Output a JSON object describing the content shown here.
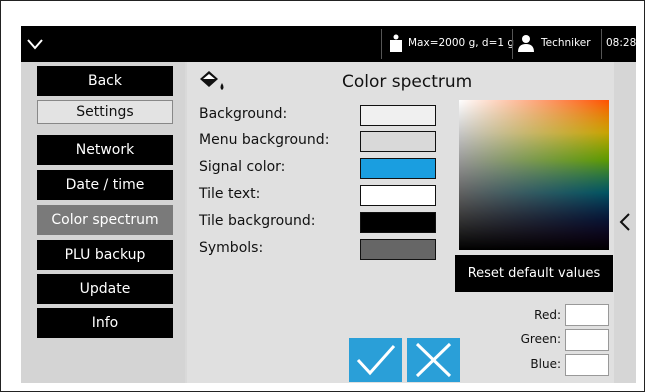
{
  "status_bar": {
    "scale_info": "Max=2000 g, d=1 g",
    "user": "Techniker",
    "time": "08:28"
  },
  "menu": {
    "items": [
      {
        "label": "Back"
      },
      {
        "label": "Settings"
      },
      {
        "label": "Network"
      },
      {
        "label": "Date / time"
      },
      {
        "label": "Color spectrum"
      },
      {
        "label": "PLU backup"
      },
      {
        "label": "Update"
      },
      {
        "label": "Info"
      }
    ],
    "active": "Color spectrum"
  },
  "main": {
    "title": "Color spectrum",
    "rows": [
      {
        "label": "Background:",
        "color": "#f0f0f0"
      },
      {
        "label": "Menu background:",
        "color": "#d9d9d9"
      },
      {
        "label": "Signal color:",
        "color": "#1a9ee0"
      },
      {
        "label": "Tile text:",
        "color": "#ffffff"
      },
      {
        "label": "Tile background:",
        "color": "#000000"
      },
      {
        "label": "Symbols:",
        "color": "#666666"
      }
    ],
    "reset_label": "Reset default values",
    "rgb": {
      "red_label": "Red:",
      "green_label": "Green:",
      "blue_label": "Blue:",
      "red_value": "",
      "green_value": "",
      "blue_value": ""
    }
  },
  "colors": {
    "accent": "#2a9fd8",
    "status_bar": "#000000",
    "tile": "#000000",
    "active_tile": "#7a7a7a"
  },
  "icons": [
    "chevron-down-icon",
    "weight-icon",
    "user-icon",
    "paint-bucket-icon",
    "chevron-left-icon",
    "check-icon",
    "close-icon"
  ]
}
